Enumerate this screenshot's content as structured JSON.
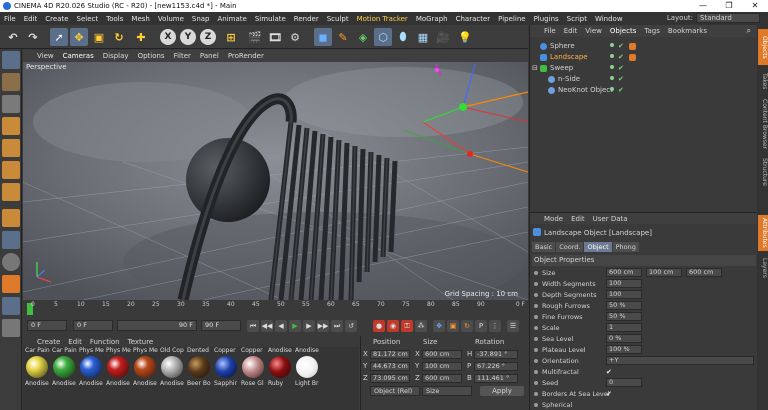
{
  "titlebar": {
    "title": "CINEMA 4D R20.026 Studio (RC - R20) - [new1153.c4d *] - Main",
    "minimize": "—",
    "maximize": "❐",
    "close": "✕"
  },
  "menubar": {
    "items": [
      "File",
      "Edit",
      "Create",
      "Select",
      "Tools",
      "Mesh",
      "Volume",
      "Snap",
      "Animate",
      "Simulate",
      "Render",
      "Sculpt",
      "Motion Tracker",
      "MoGraph",
      "Character",
      "Pipeline",
      "Plugins",
      "Script",
      "Window"
    ],
    "layout_label": "Layout:",
    "layout_value": "Standard"
  },
  "toolbar": {
    "x_label": "X",
    "y_label": "Y",
    "z_label": "Z"
  },
  "viewport": {
    "menu": [
      "View",
      "Cameras",
      "Display",
      "Options",
      "Filter",
      "Panel",
      "ProRender"
    ],
    "label": "Perspective",
    "grid_spacing": "Grid Spacing : 10 cm"
  },
  "timeline": {
    "ticks": [
      "0",
      "5",
      "10",
      "15",
      "20",
      "25",
      "30",
      "35",
      "40",
      "45",
      "50",
      "55",
      "60",
      "65",
      "70",
      "75",
      "80",
      "85",
      "90"
    ],
    "end_frame": "0 F"
  },
  "transport": {
    "start": "0 F",
    "current": "0 F",
    "end_min": "90 F",
    "end": "90 F"
  },
  "materials": {
    "menu": [
      "Create",
      "Edit",
      "Function",
      "Texture"
    ],
    "items": [
      {
        "top": "Car Pain",
        "bottom": "Anodise",
        "color": "#e8d84a"
      },
      {
        "top": "Car Pain",
        "bottom": "Anodise",
        "color": "#3fae3f"
      },
      {
        "top": "Phys Me",
        "bottom": "Anodise",
        "color": "#2a5fd6"
      },
      {
        "top": "Phys Me",
        "bottom": "Anodise",
        "color": "#c41e1e"
      },
      {
        "top": "Phys Me",
        "bottom": "Anodise",
        "color": "#b84a1c"
      },
      {
        "top": "Old Cop",
        "bottom": "Anodise",
        "color": "#bfbfbf"
      },
      {
        "top": "Dented",
        "bottom": "Beer Bo",
        "color": "#5a3a1a"
      },
      {
        "top": "Copper",
        "bottom": "Sapphir",
        "color": "#1c3fa8"
      },
      {
        "top": "Copper",
        "bottom": "Rose Gl",
        "color": "#c08a8a"
      },
      {
        "top": "Anodise",
        "bottom": "Ruby",
        "color": "#8a1010"
      },
      {
        "top": "Anodise",
        "bottom": "Light Br",
        "color": "#f2f2f2"
      }
    ]
  },
  "coordinates": {
    "position_label": "Position",
    "size_label": "Size",
    "rotation_label": "Rotation",
    "rows": [
      {
        "axis": "X",
        "pos": "81.172 cm",
        "size_axis": "X",
        "size": "600 cm",
        "rot_axis": "H",
        "rot": "-37.891 °"
      },
      {
        "axis": "Y",
        "pos": "44.673 cm",
        "size_axis": "Y",
        "size": "100 cm",
        "rot_axis": "P",
        "rot": "67.226 °"
      },
      {
        "axis": "Z",
        "pos": "73.095 cm",
        "size_axis": "Z",
        "size": "600 cm",
        "rot_axis": "B",
        "rot": "111.461 °"
      }
    ],
    "mode": "Object (Rel)",
    "size_mode": "Size",
    "apply": "Apply"
  },
  "object_manager": {
    "menu": [
      "File",
      "Edit",
      "View",
      "Objects",
      "Tags",
      "Bookmarks"
    ],
    "objects": [
      {
        "name": "Sphere",
        "indent": 0,
        "icon_color": "#4a8fe0",
        "highlight": false,
        "has_tag": true
      },
      {
        "name": "Landscape",
        "indent": 0,
        "icon_color": "#4a8fe0",
        "highlight": true,
        "has_tag": true
      },
      {
        "name": "Sweep",
        "indent": 0,
        "icon_color": "#3fbf3f",
        "highlight": false,
        "has_tag": false
      },
      {
        "name": "n-Side",
        "indent": 1,
        "icon_color": "#6fa0e0",
        "highlight": false,
        "has_tag": false
      },
      {
        "name": "NeoKnot Object",
        "indent": 1,
        "icon_color": "#6fa0e0",
        "highlight": false,
        "has_tag": false
      }
    ]
  },
  "attributes": {
    "menu": [
      "Mode",
      "Edit",
      "User Data"
    ],
    "title": "Landscape Object [Landscape]",
    "tabs": [
      "Basic",
      "Coord.",
      "Object",
      "Phong"
    ],
    "active_tab": "Object",
    "section": "Object Properties",
    "props": [
      {
        "label": "Size",
        "v1": "600 cm",
        "v2": "100 cm",
        "v3": "600 cm"
      },
      {
        "label": "Width Segments",
        "v1": "100"
      },
      {
        "label": "Depth Segments",
        "v1": "100"
      },
      {
        "label": "Rough Furrows",
        "v1": "50 %"
      },
      {
        "label": "Fine Furrows",
        "v1": "50 %"
      },
      {
        "label": "Scale",
        "v1": "1"
      },
      {
        "label": "Sea Level",
        "v1": "0 %"
      },
      {
        "label": "Plateau Level",
        "v1": "100 %"
      },
      {
        "label": "Orientation",
        "wide": "+Y"
      },
      {
        "label": "Multifractal",
        "check": "✔"
      },
      {
        "label": "Seed",
        "v1": "0"
      },
      {
        "label": "Borders At Sea Level",
        "check": "✔"
      },
      {
        "label": "Spherical",
        "check": ""
      }
    ]
  },
  "side_tabs": [
    "Objects",
    "Takes",
    "Content Browser",
    "Structure",
    "Attributes",
    "Layers"
  ],
  "colors": {
    "accent": "#e07a2b",
    "highlight": "#ffb347",
    "selection": "#5b6f8a",
    "viewport_bg": "#6d7278"
  }
}
